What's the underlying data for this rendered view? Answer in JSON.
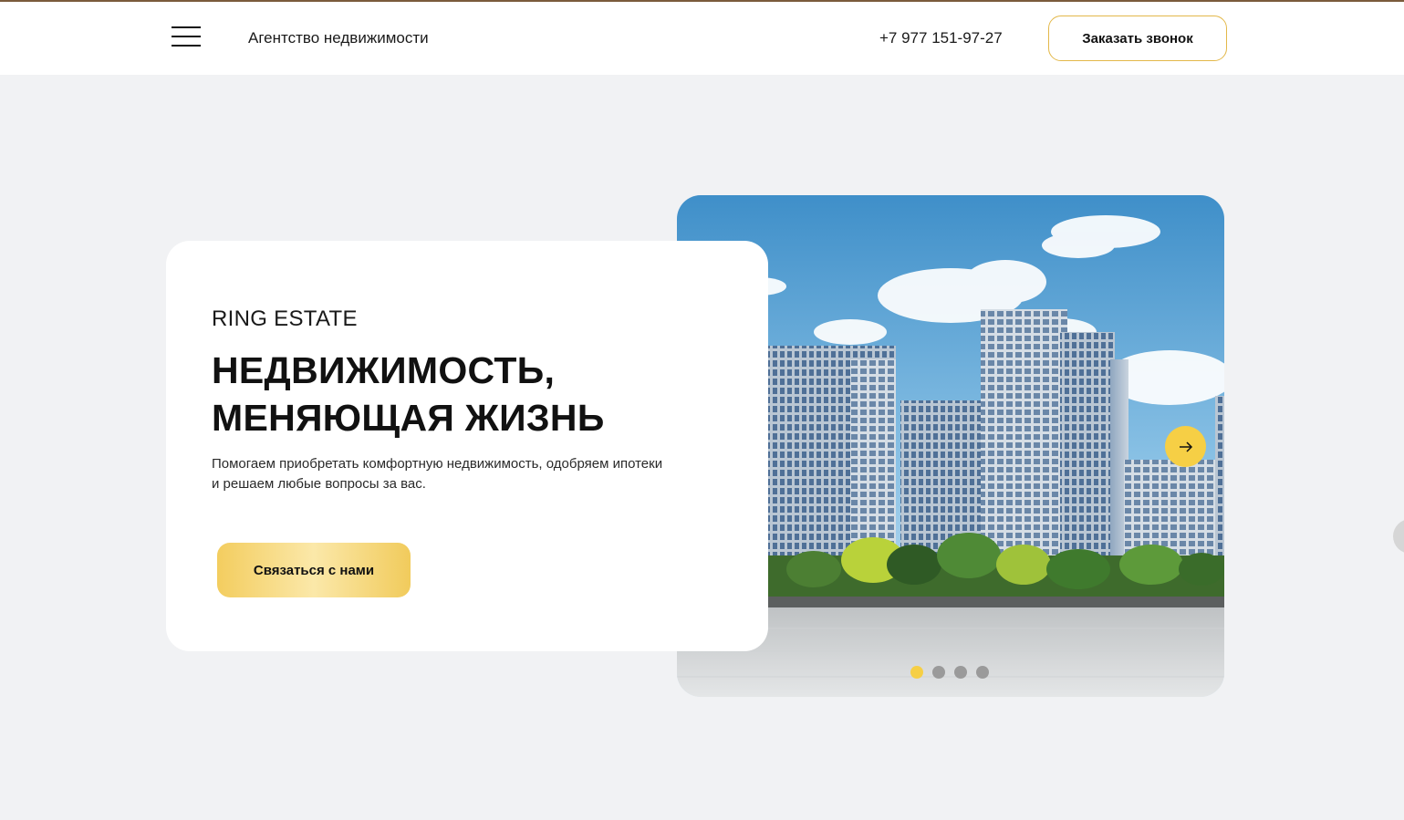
{
  "header": {
    "tagline": "Агентство недвижимости",
    "phone": "+7 977 151-97-27",
    "callback_label": "Заказать звонок",
    "menu_icon": "hamburger-menu-icon"
  },
  "hero": {
    "eyebrow": "RING ESTATE",
    "headline_line1": "НЕДВИЖИМОСТЬ,",
    "headline_line2": "МЕНЯЮЩАЯ ЖИЗНЬ",
    "lead_line1": "Помогаем приобретать комфортную недвижимость, одобряем ипотеки",
    "lead_line2": "и решаем любые вопросы за вас.",
    "cta_label": "Связаться с нами"
  },
  "slider": {
    "image_subject": "modern-glass-residential-towers",
    "next_icon": "arrow-right-icon",
    "slide_count": 4,
    "active_slide": 1
  },
  "colors": {
    "accent": "#f6cf45",
    "top_border": "#7a5b3c",
    "page_bg": "#f1f2f4"
  }
}
